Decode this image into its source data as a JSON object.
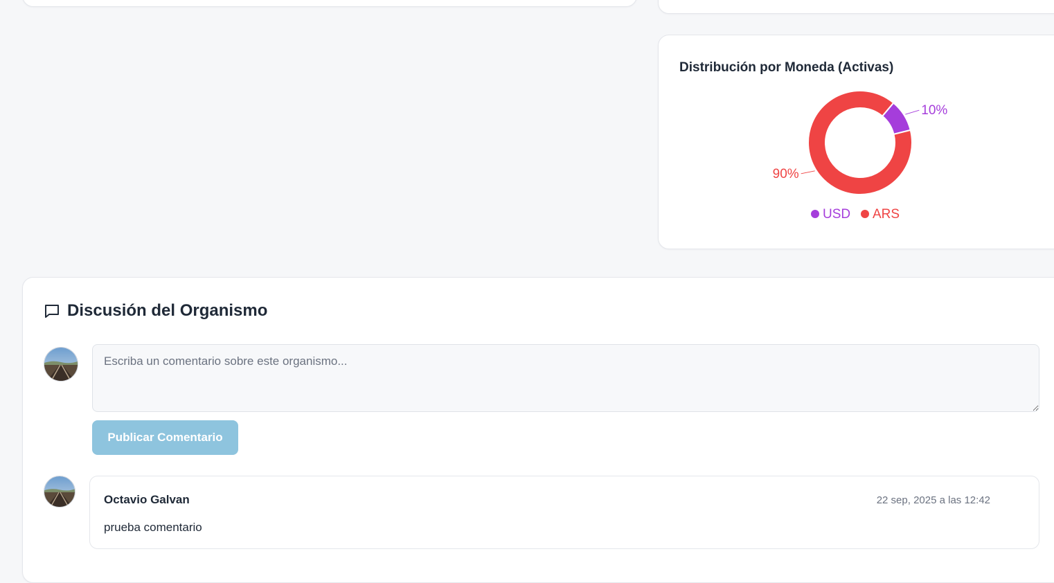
{
  "currency_chart": {
    "title": "Distribución por Moneda (Activas)"
  },
  "chart_data": {
    "type": "pie",
    "title": "Distribución por Moneda (Activas)",
    "donut": true,
    "legend_position": "bottom",
    "slices": [
      {
        "label": "USD",
        "value": 10,
        "value_label": "10%",
        "color": "#a53ddb"
      },
      {
        "label": "ARS",
        "value": 90,
        "value_label": "90%",
        "color": "#ef4444"
      }
    ]
  },
  "discussion": {
    "title": "Discusión del Organismo",
    "icon": "message-square-icon",
    "compose": {
      "placeholder": "Escriba un comentario sobre este organismo...",
      "value": "",
      "publish_label": "Publicar Comentario",
      "publish_color": "#8ec4de"
    },
    "comments": [
      {
        "author": "Octavio Galvan",
        "date": "22 sep, 2025 a las 12:42",
        "text": "prueba comentario"
      }
    ]
  }
}
